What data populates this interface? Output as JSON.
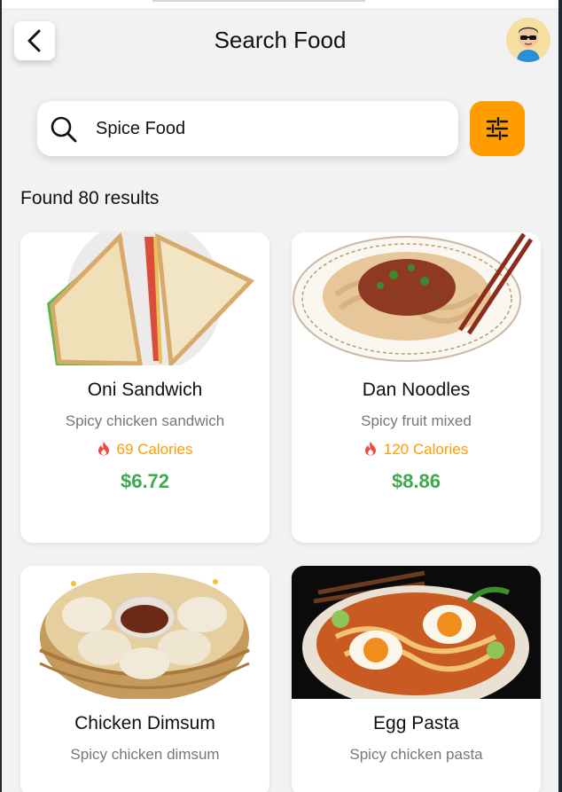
{
  "header": {
    "title": "Search Food"
  },
  "search": {
    "value": "Spice Food"
  },
  "results_label": "Found 80 results",
  "foods": [
    {
      "name": "Oni Sandwich",
      "description": "Spicy chicken sandwich",
      "calories": "69 Calories",
      "price": "$6.72"
    },
    {
      "name": "Dan Noodles",
      "description": "Spicy fruit mixed",
      "calories": "120 Calories",
      "price": "$8.86"
    },
    {
      "name": "Chicken Dimsum",
      "description": "Spicy chicken dimsum"
    },
    {
      "name": "Egg Pasta",
      "description": "Spicy chicken pasta"
    }
  ],
  "icons": {
    "back": "chevron-left-icon",
    "search": "search-icon",
    "filter": "sliders-icon",
    "calories": "flame-icon"
  },
  "colors": {
    "accent": "#ff9c00",
    "price": "#3daa4e",
    "background": "#f2f2f2"
  }
}
